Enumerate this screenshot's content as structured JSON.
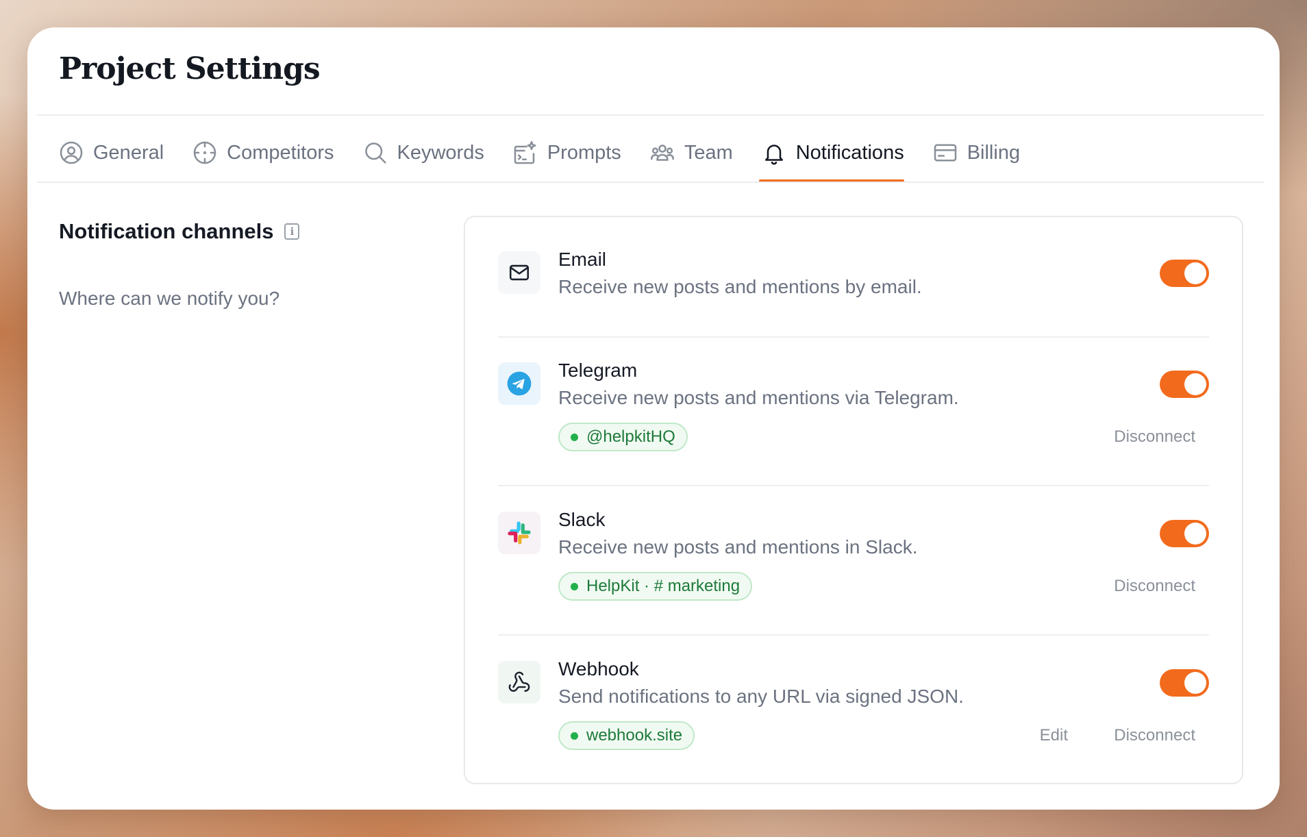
{
  "page": {
    "title": "Project Settings"
  },
  "tabs": [
    {
      "label": "General",
      "icon": "user-circle-icon",
      "active": false
    },
    {
      "label": "Competitors",
      "icon": "crosshair-icon",
      "active": false
    },
    {
      "label": "Keywords",
      "icon": "search-icon",
      "active": false
    },
    {
      "label": "Prompts",
      "icon": "terminal-sparkle-icon",
      "active": false
    },
    {
      "label": "Team",
      "icon": "users-icon",
      "active": false
    },
    {
      "label": "Notifications",
      "icon": "bell-icon",
      "active": true
    },
    {
      "label": "Billing",
      "icon": "credit-card-icon",
      "active": false
    }
  ],
  "section": {
    "title": "Notification channels",
    "info_icon": "info-icon",
    "subtitle": "Where can we notify you?"
  },
  "channels": [
    {
      "name": "Email",
      "description": "Receive new posts and mentions by email.",
      "icon": "mail-icon",
      "enabled": true
    },
    {
      "name": "Telegram",
      "description": "Receive new posts and mentions via Telegram.",
      "icon": "telegram-icon",
      "enabled": true,
      "connection": "@helpkitHQ",
      "disconnect_label": "Disconnect"
    },
    {
      "name": "Slack",
      "description": "Receive new posts and mentions in Slack.",
      "icon": "slack-icon",
      "enabled": true,
      "connection": "HelpKit · # marketing",
      "disconnect_label": "Disconnect"
    },
    {
      "name": "Webhook",
      "description": "Send notifications to any URL via signed JSON.",
      "icon": "webhook-icon",
      "enabled": true,
      "connection": "webhook.site",
      "edit_label": "Edit",
      "disconnect_label": "Disconnect"
    }
  ],
  "colors": {
    "accent": "#f26b1d",
    "connected_green": "#22b04a",
    "telegram_blue": "#2aa3e3"
  }
}
